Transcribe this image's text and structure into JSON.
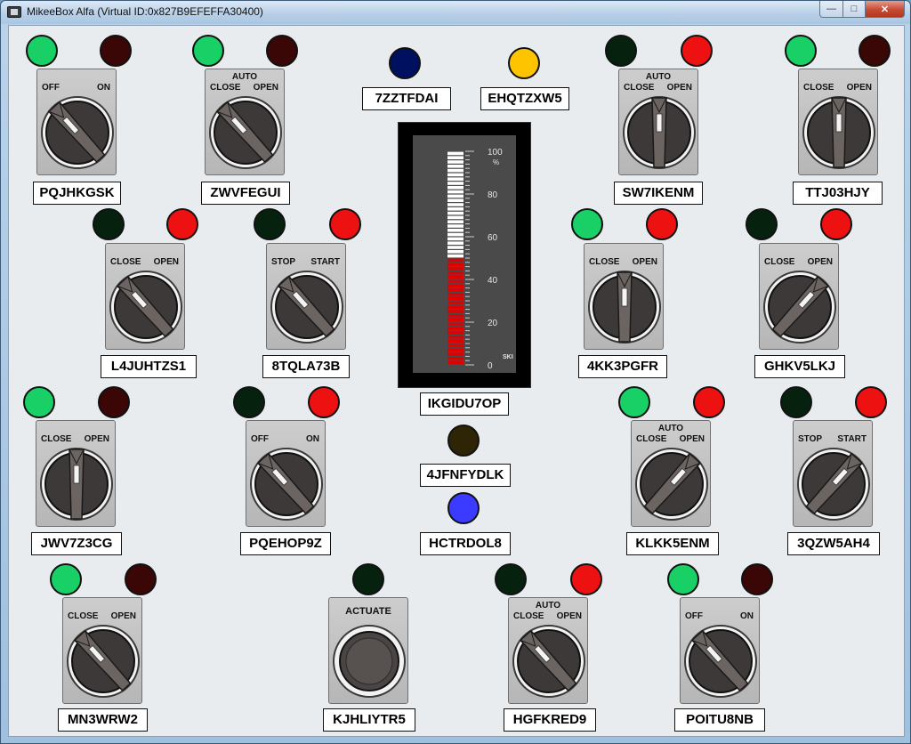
{
  "window": {
    "title": "MikeeBox Alfa (Virtual ID:0x827B9EFEFFA30400)"
  },
  "switches": [
    {
      "id": "s1",
      "tag": "PQJHKGSK",
      "left_label": "OFF",
      "right_label": "ON",
      "top_label": "",
      "position": "left",
      "lamps": [
        "green",
        "darkred"
      ]
    },
    {
      "id": "s2",
      "tag": "ZWVFEGUI",
      "left_label": "CLOSE",
      "right_label": "OPEN",
      "top_label": "AUTO",
      "position": "left",
      "lamps": [
        "green",
        "darkred"
      ]
    },
    {
      "id": "s3",
      "tag": "SW7IKENM",
      "left_label": "CLOSE",
      "right_label": "OPEN",
      "top_label": "AUTO",
      "position": "center",
      "lamps": [
        "darkgreen",
        "red"
      ]
    },
    {
      "id": "s4",
      "tag": "TTJ03HJY",
      "left_label": "CLOSE",
      "right_label": "OPEN",
      "top_label": "",
      "position": "center",
      "lamps": [
        "green",
        "darkred"
      ]
    },
    {
      "id": "s5",
      "tag": "L4JUHTZS1",
      "left_label": "CLOSE",
      "right_label": "OPEN",
      "top_label": "",
      "position": "left",
      "lamps": [
        "darkgreen",
        "red"
      ]
    },
    {
      "id": "s6",
      "tag": "8TQLA73B",
      "left_label": "STOP",
      "right_label": "START",
      "top_label": "",
      "position": "left",
      "lamps": [
        "darkgreen",
        "red"
      ]
    },
    {
      "id": "s7",
      "tag": "4KK3PGFR",
      "left_label": "CLOSE",
      "right_label": "OPEN",
      "top_label": "",
      "position": "center",
      "lamps": [
        "green",
        "red"
      ]
    },
    {
      "id": "s8",
      "tag": "GHKV5LKJ",
      "left_label": "CLOSE",
      "right_label": "OPEN",
      "top_label": "",
      "position": "right",
      "lamps": [
        "darkgreen",
        "red"
      ]
    },
    {
      "id": "s9",
      "tag": "JWV7Z3CG",
      "left_label": "CLOSE",
      "right_label": "OPEN",
      "top_label": "",
      "position": "center",
      "lamps": [
        "green",
        "darkred"
      ]
    },
    {
      "id": "s10",
      "tag": "PQEHOP9Z",
      "left_label": "OFF",
      "right_label": "ON",
      "top_label": "",
      "position": "left",
      "lamps": [
        "darkgreen",
        "red"
      ]
    },
    {
      "id": "s11",
      "tag": "KLKK5ENM",
      "left_label": "CLOSE",
      "right_label": "OPEN",
      "top_label": "AUTO",
      "position": "right",
      "lamps": [
        "green",
        "red"
      ]
    },
    {
      "id": "s12",
      "tag": "3QZW5AH4",
      "left_label": "STOP",
      "right_label": "START",
      "top_label": "",
      "position": "right",
      "lamps": [
        "darkgreen",
        "red"
      ]
    },
    {
      "id": "s13",
      "tag": "MN3WRW2",
      "left_label": "CLOSE",
      "right_label": "OPEN",
      "top_label": "",
      "position": "left",
      "lamps": [
        "green",
        "darkred"
      ]
    },
    {
      "id": "s14",
      "tag": "HGFKRED9",
      "left_label": "CLOSE",
      "right_label": "OPEN",
      "top_label": "AUTO",
      "position": "left",
      "lamps": [
        "darkgreen",
        "red"
      ]
    },
    {
      "id": "s15",
      "tag": "POITU8NB",
      "left_label": "OFF",
      "right_label": "ON",
      "top_label": "",
      "position": "left",
      "lamps": [
        "green",
        "darkred"
      ]
    }
  ],
  "pushbutton": {
    "tag": "KJHLIYTR5",
    "label": "ACTUATE",
    "lamp": "darkgreen"
  },
  "indicators": [
    {
      "id": "i1",
      "tag": "7ZZTFDAI",
      "color": "navy"
    },
    {
      "id": "i2",
      "tag": "EHQTZXW5",
      "color": "amber"
    },
    {
      "id": "i3",
      "tag": "4JFNFYDLK",
      "color": "brown"
    },
    {
      "id": "i4",
      "tag": "HCTRDOL8",
      "color": "blue"
    }
  ],
  "meter": {
    "tag": "IKGIDU7OP",
    "value_percent": 50,
    "unit": "%",
    "ticks": [
      "100",
      "80",
      "60",
      "40",
      "20",
      "0"
    ],
    "brand": "SKI",
    "fill_color": "#e00000"
  },
  "colors": {
    "green": "#19d067",
    "red": "#ee1111",
    "darkred": "#3a0606",
    "darkgreen": "#06220f",
    "navy": "#001060",
    "amber": "#ffc400",
    "brown": "#2e2506",
    "blue": "#3b3bff"
  }
}
